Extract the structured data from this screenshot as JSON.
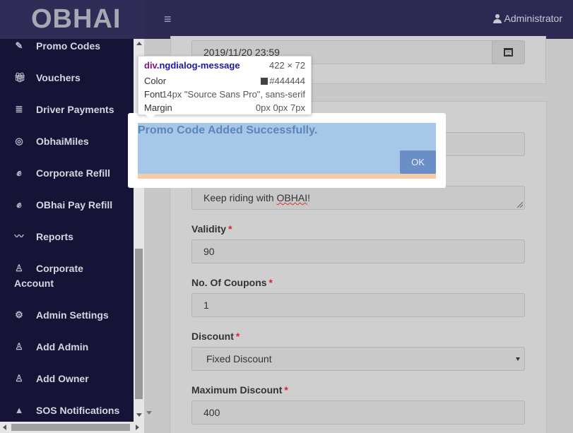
{
  "header": {
    "logo": "OBHAI",
    "user_label": "Administrator"
  },
  "sidebar": {
    "items": [
      {
        "label": "Promo Codes",
        "icon": "edit-icon"
      },
      {
        "label": "Vouchers",
        "icon": "gift-icon"
      },
      {
        "label": "Driver Payments",
        "icon": "database-icon"
      },
      {
        "label": "ObhaiMiles",
        "icon": "bullseye-icon"
      },
      {
        "label": "Corporate Refill",
        "icon": "refill-icon"
      },
      {
        "label": "OBhai Pay Refill",
        "icon": "refill-icon"
      },
      {
        "label": "Reports",
        "icon": "line-chart-icon"
      },
      {
        "label": "Corporate",
        "label2": "Account",
        "icon": "user-outline-icon"
      },
      {
        "label": "Admin Settings",
        "icon": "gear-icon"
      },
      {
        "label": "Add Admin",
        "icon": "user-outline-icon"
      },
      {
        "label": "Add Owner",
        "icon": "user-outline-icon"
      },
      {
        "label": "SOS Notifications",
        "icon": "warning-icon"
      }
    ]
  },
  "form": {
    "datetime_value": "2019/11/20 23:59",
    "message_value": "Keep riding with OBHAI!",
    "validity_label": "Validity",
    "validity_value": "90",
    "coupons_label": "No. Of Coupons",
    "coupons_value": "1",
    "discount_label": "Discount",
    "discount_value": "Fixed Discount",
    "max_discount_label": "Maximum Discount",
    "max_discount_value": "400",
    "required_mark": "*"
  },
  "dialog": {
    "message": "Promo Code Added Successfully.",
    "ok_label": "OK"
  },
  "inspector": {
    "element": "div",
    "class": ".ngdialog-message",
    "size": "422 × 72",
    "color_label": "Color",
    "color_value": "#444444",
    "font_label": "Font",
    "font_value": "14px \"Source Sans Pro\", sans-serif",
    "margin_label": "Margin",
    "margin_value": "0px 0px 7px"
  }
}
